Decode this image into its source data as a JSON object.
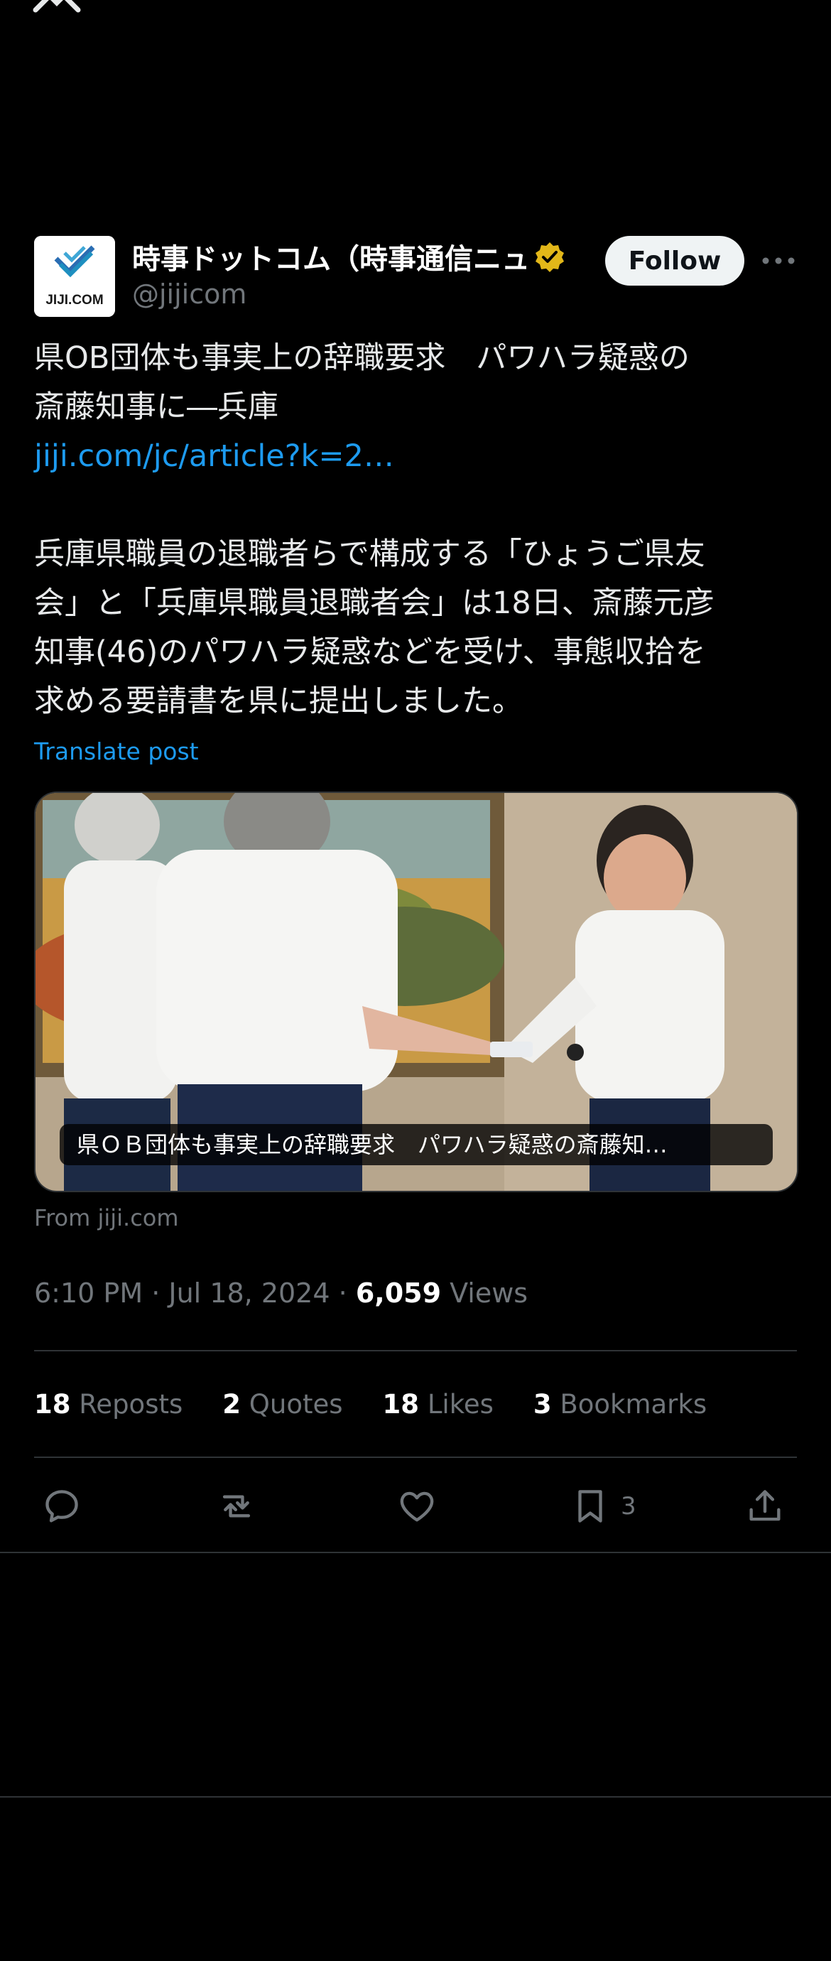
{
  "account": {
    "display_name": "時事ドットコム（時事通信ニュ",
    "handle": "@jijicom",
    "avatar_text": "JIJI.COM",
    "follow_label": "Follow"
  },
  "post": {
    "headline_line1": "県OB団体も事実上の辞職要求　パワハラ疑惑の",
    "headline_line2": "斎藤知事に―兵庫",
    "link": "jiji.com/jc/article?k=2…",
    "body_line1": "兵庫県職員の退職者らで構成する「ひょうご県友",
    "body_line2": "会」と「兵庫県職員退職者会」は18日、斎藤元彦",
    "body_line3": "知事(46)のパワハラ疑惑などを受け、事態収拾を",
    "body_line4": "求める要請書を県に提出しました。",
    "translate_label": "Translate post"
  },
  "card": {
    "caption": "県ＯＢ団体も事実上の辞職要求　パワハラ疑惑の斎藤知…",
    "from": "From jiji.com"
  },
  "meta": {
    "time": "6:10 PM",
    "date": "Jul 18, 2024",
    "views_count": "6,059",
    "views_label": "Views"
  },
  "stats": {
    "reposts_count": "18",
    "reposts_label": "Reposts",
    "quotes_count": "2",
    "quotes_label": "Quotes",
    "likes_count": "18",
    "likes_label": "Likes",
    "bookmarks_count": "3",
    "bookmarks_label": "Bookmarks"
  },
  "actions": {
    "bookmark_count": "3"
  },
  "colors": {
    "background": "#000000",
    "link": "#1d9bf0",
    "muted": "#71767b",
    "verified_badge": "#e2b719"
  }
}
